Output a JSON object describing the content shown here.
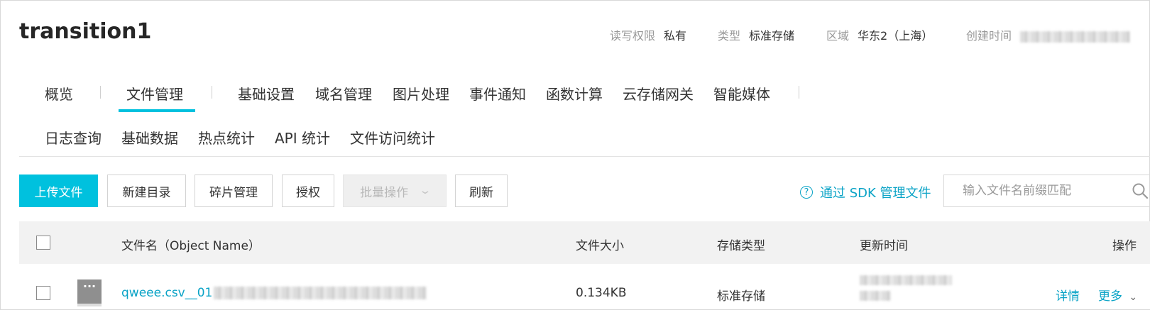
{
  "bucket": {
    "name": "transition1",
    "meta": {
      "rw_label": "读写权限",
      "rw_value": "私有",
      "type_label": "类型",
      "type_value": "标准存储",
      "region_label": "区域",
      "region_value": "华东2（上海）",
      "created_label": "创建时间"
    }
  },
  "tabs_row1": [
    "概览",
    "文件管理",
    "基础设置",
    "域名管理",
    "图片处理",
    "事件通知",
    "函数计算",
    "云存储网关",
    "智能媒体"
  ],
  "active_tab": "文件管理",
  "tabs_row2": [
    "日志查询",
    "基础数据",
    "热点统计",
    "API 统计",
    "文件访问统计"
  ],
  "toolbar": {
    "upload": "上传文件",
    "new_dir": "新建目录",
    "fragments": "碎片管理",
    "authorize": "授权",
    "batch": "批量操作",
    "refresh": "刷新",
    "sdk_link": "通过 SDK 管理文件",
    "search_placeholder": "输入文件名前缀匹配"
  },
  "table": {
    "columns": {
      "name": "文件名（Object Name）",
      "size": "文件大小",
      "storage": "存储类型",
      "updated": "更新时间",
      "actions": "操作"
    },
    "rows": [
      {
        "name_visible": "qweee.csv__01",
        "size": "0.134KB",
        "storage": "标准存储",
        "detail": "详情",
        "more": "更多"
      }
    ]
  },
  "colors": {
    "accent": "#00c1de",
    "link": "#0aa3c6"
  },
  "icons": [
    "help-circle-icon",
    "search-icon",
    "chevron-down-icon",
    "file-icon"
  ]
}
